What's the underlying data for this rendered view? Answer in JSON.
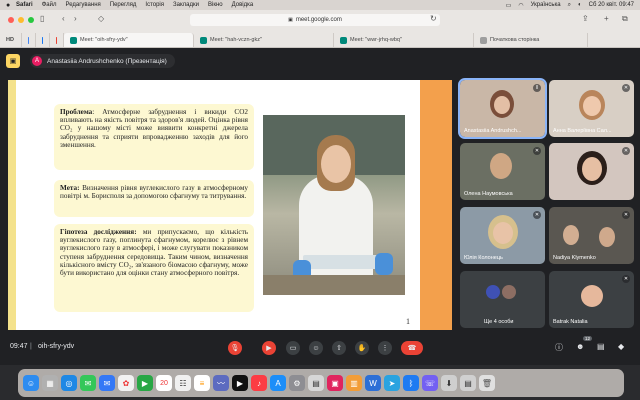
{
  "menubar": {
    "apple": "",
    "items": [
      "Safari",
      "Файл",
      "Редагування",
      "Перегляд",
      "Історія",
      "Закладки",
      "Вікно",
      "Довідка"
    ],
    "language": "Українська",
    "datetime": "Сб 20 квіт. 09:47"
  },
  "browser": {
    "url": "meet.google.com",
    "tabs": [
      {
        "label": "Meet: \"oih-sfry-ydv\"",
        "color": "#00897b",
        "active": true
      },
      {
        "label": "Meet: \"hah-vczn-gkz\"",
        "color": "#00897b",
        "active": false
      },
      {
        "label": "Meet: \"wwr-jrhq-wbq\"",
        "color": "#00897b",
        "active": false
      },
      {
        "label": "Початкова сторінка",
        "color": "#9e9e9e",
        "active": false
      }
    ],
    "bookmark_hd": "HD"
  },
  "meet": {
    "presenter": "Anastasiia Andrushchenko (Презентація)",
    "presenter_initial": "A",
    "time": "09:47",
    "separator": "|",
    "meeting_code": "oih-sfry-ydv",
    "participants_count_badge": "12",
    "more_people": "Ще 4 особи"
  },
  "slide": {
    "problem_label": "Проблема",
    "problem_text": ": Атмосферне забруднення і викиди СО2 впливають на якість повітря та здоров'я людей. Оцінка рівня СО₂ у нашому місті може виявити конкретні джерела забруднення та сприяти впровадженню заходів для його зменшення.",
    "goal_label": "Мета:",
    "goal_text": " Визначення рівня вуглекислого газу в атмосферному повітрі м. Борисполя за допомогою сфагнуму та титрування.",
    "hypothesis_label": "Гіпотеза дослідження:",
    "hypothesis_text": " ми припускаємо, що кількість вуглекислого газу, поглинута сфагнумом, корелює з рівнем вуглекислого газу в атмосфері, і може слугувати показником ступеня забруднення середовища. Таким чином, визначення кількісного вмісту СО₂, зв'язаного біомасою сфагнуму, може бути використано для оцінки стану атмосферного повітря.",
    "page_number": "1"
  },
  "participants": [
    {
      "name": "Anastasiia Andrushch...",
      "speaking": true
    },
    {
      "name": "Анна Валеріївна Сал...",
      "speaking": false
    },
    {
      "name": "Олена Наумовська",
      "speaking": false
    },
    {
      "name": "",
      "speaking": false
    },
    {
      "name": "Юлія Колонець",
      "speaking": false
    },
    {
      "name": "Nadiya Klymenko",
      "speaking": false
    },
    {
      "name": "Ще 4 особи",
      "speaking": false
    },
    {
      "name": "Batrak Natalia",
      "speaking": false
    }
  ],
  "dock": {
    "calendar_date": "20"
  }
}
